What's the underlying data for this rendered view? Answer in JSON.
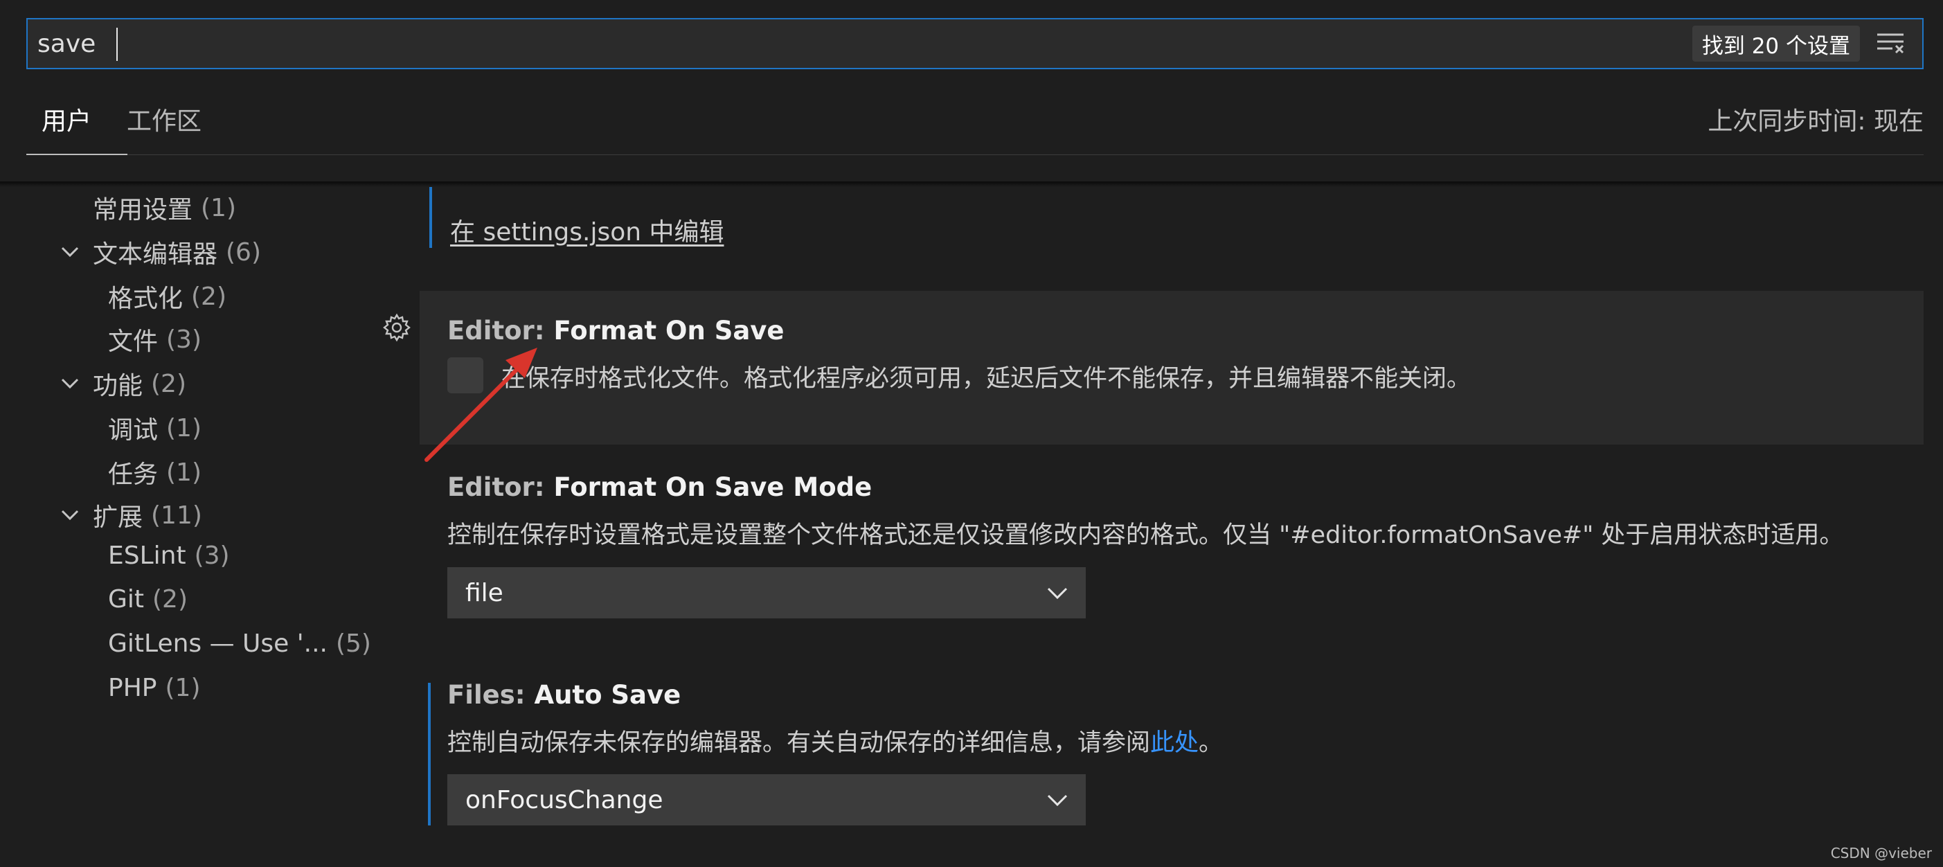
{
  "search": {
    "value": "save",
    "result_count": "找到 20 个设置"
  },
  "tabs": [
    {
      "label": "用户"
    },
    {
      "label": "工作区"
    }
  ],
  "sync_status": "上次同步时间: 现在",
  "tree": [
    {
      "label": "常用设置",
      "count": "(1)"
    },
    {
      "label": "文本编辑器",
      "count": "(6)"
    },
    {
      "label": "格式化",
      "count": "(2)"
    },
    {
      "label": "文件",
      "count": "(3)"
    },
    {
      "label": "功能",
      "count": "(2)"
    },
    {
      "label": "调试",
      "count": "(1)"
    },
    {
      "label": "任务",
      "count": "(1)"
    },
    {
      "label": "扩展",
      "count": "(11)"
    },
    {
      "label": "ESLint",
      "count": "(3)"
    },
    {
      "label": "Git",
      "count": "(2)"
    },
    {
      "label": "GitLens — Use '...",
      "count": "(5)"
    },
    {
      "label": "PHP",
      "count": "(1)"
    }
  ],
  "edit_in_json": "在 settings.json 中编辑",
  "settings": [
    {
      "category": "Editor: ",
      "name": "Format On Save",
      "description": "在保存时格式化文件。格式化程序必须可用，延迟后文件不能保存，并且编辑器不能关闭。"
    },
    {
      "category": "Editor: ",
      "name": "Format On Save Mode",
      "description": "控制在保存时设置格式是设置整个文件格式还是仅设置修改内容的格式。仅当 \"#editor.formatOnSave#\" 处于启用状态时适用。",
      "value": "file"
    },
    {
      "category": "Files: ",
      "name": "Auto Save",
      "description_prefix": "控制自动保存未保存的编辑器。有关自动保存的详细信息，请参阅",
      "description_link": "此处",
      "description_suffix": "。",
      "value": "onFocusChange"
    }
  ],
  "watermark": "CSDN @vieber",
  "colors": {
    "accent": "#1f75c5",
    "link": "#3794ff",
    "annotation_arrow": "#d9352c"
  }
}
